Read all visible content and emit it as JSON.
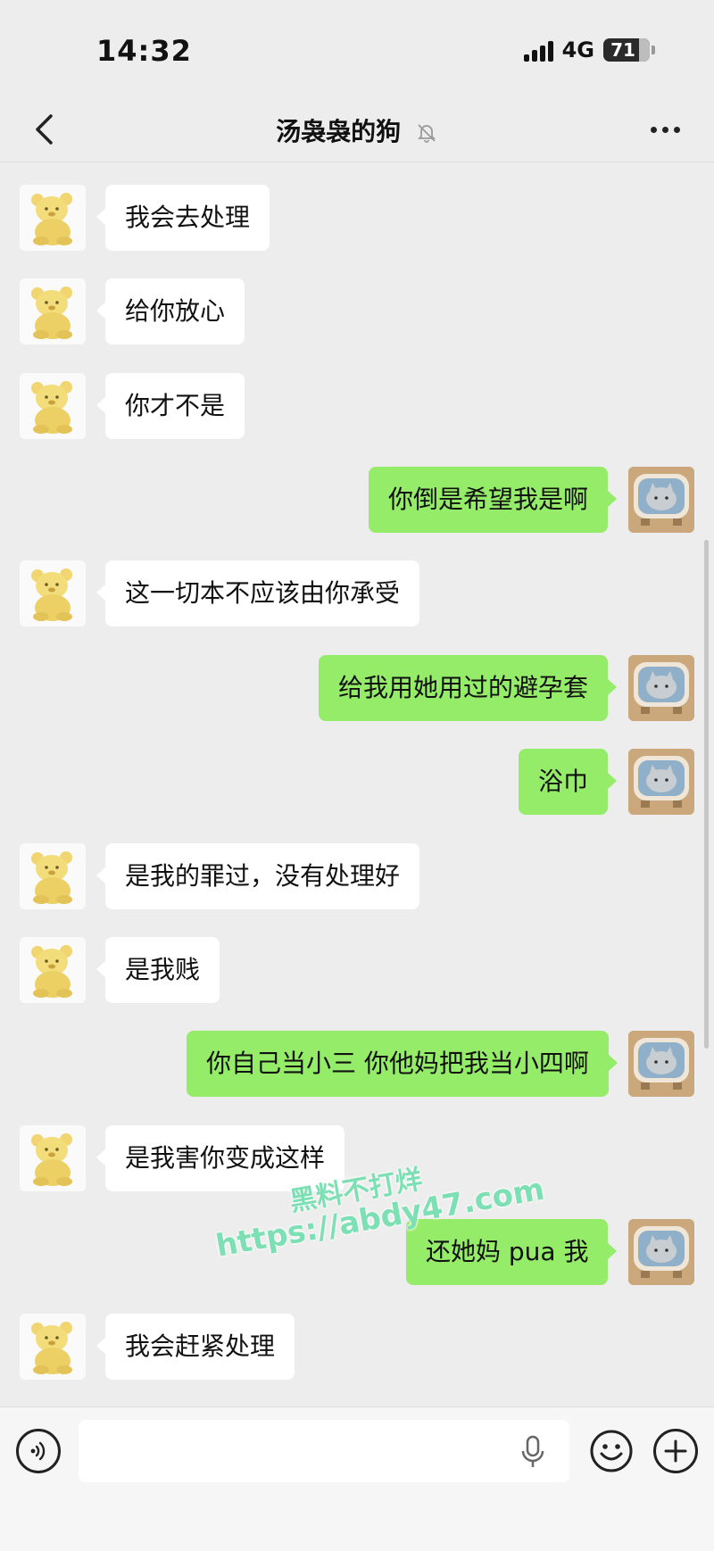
{
  "status": {
    "time": "14:32",
    "network": "4G",
    "battery": "71"
  },
  "header": {
    "title": "汤袅袅的狗"
  },
  "messages": [
    {
      "side": "left",
      "text": "我会去处理"
    },
    {
      "side": "left",
      "text": "给你放心"
    },
    {
      "side": "left",
      "text": "你才不是"
    },
    {
      "side": "right",
      "text": "你倒是希望我是啊"
    },
    {
      "side": "left",
      "text": "这一切本不应该由你承受"
    },
    {
      "side": "right",
      "text": "给我用她用过的避孕套"
    },
    {
      "side": "right",
      "text": "浴巾"
    },
    {
      "side": "left",
      "text": "是我的罪过，没有处理好"
    },
    {
      "side": "left",
      "text": "是我贱"
    },
    {
      "side": "right",
      "text": "你自己当小三 你他妈把我当小四啊"
    },
    {
      "side": "left",
      "text": "是我害你变成这样"
    },
    {
      "side": "right",
      "text": "还她妈 pua 我"
    },
    {
      "side": "left",
      "text": "我会赶紧处理"
    }
  ],
  "watermark": {
    "line1": "黑料不打烊",
    "line2": "https://abdy47.com"
  },
  "input": {
    "placeholder": ""
  },
  "colors": {
    "background": "#ededed",
    "sent_bubble": "#95ec69",
    "received_bubble": "#ffffff"
  },
  "icons": {
    "back": "chevron-left-icon",
    "mute": "bell-off-icon",
    "more": "more-dots-icon",
    "voice": "voice-icon",
    "mic": "mic-icon",
    "emoji": "emoji-icon",
    "plus": "plus-icon"
  }
}
